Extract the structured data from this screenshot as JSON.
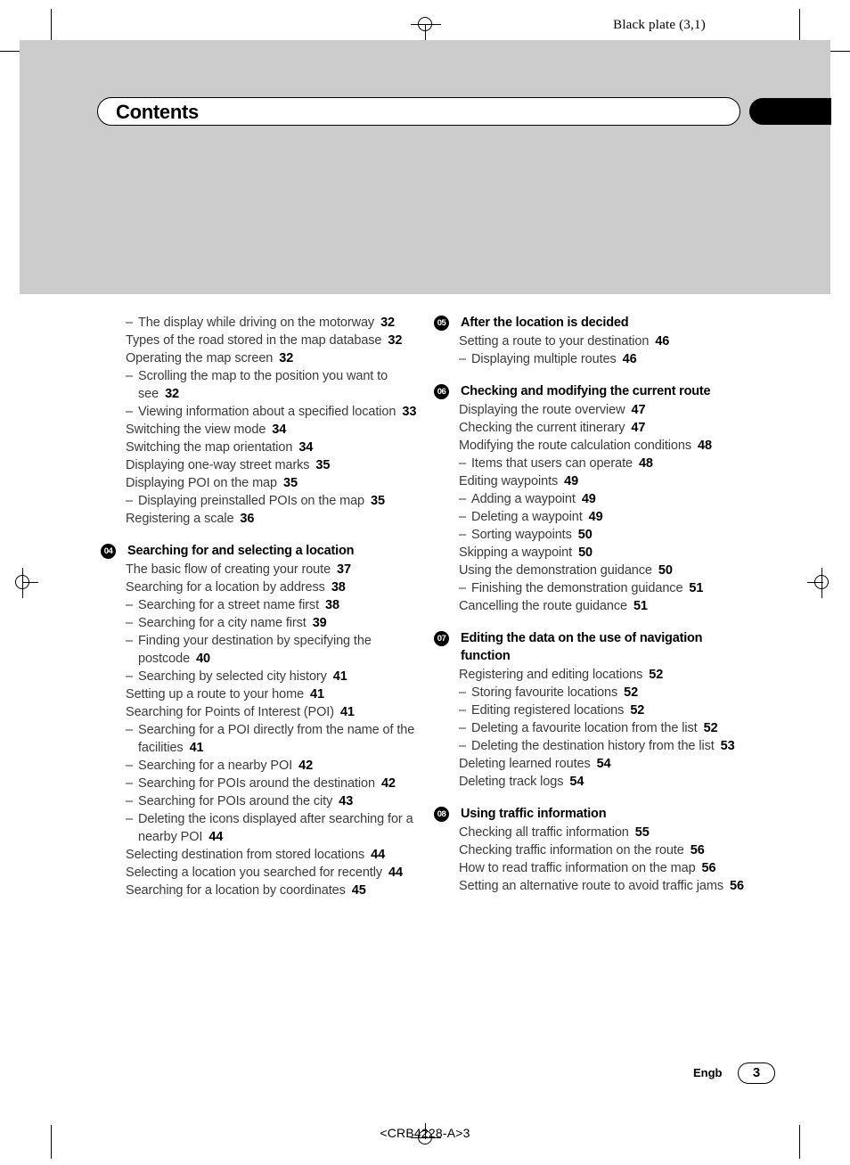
{
  "header": {
    "black_plate": "Black plate (3,1)",
    "title": "Contents"
  },
  "footer": {
    "language": "Engb",
    "page_number": "3",
    "doc_code": "<CRB4228-A>3"
  },
  "colors": {
    "band": "#cccccc",
    "tab": "#000000",
    "text": "#3b3b3b",
    "page_number_text": "#000000"
  },
  "toc": {
    "left_column": [
      {
        "kind": "sub",
        "text": "The display while driving on the motorway",
        "page": "32"
      },
      {
        "kind": "entry",
        "text": "Types of the road stored in the map database",
        "page": "32"
      },
      {
        "kind": "entry",
        "text": "Operating the map screen",
        "page": "32"
      },
      {
        "kind": "sub",
        "text": "Scrolling the map to the position you want to see",
        "page": "32"
      },
      {
        "kind": "sub",
        "text": "Viewing information about a specified location",
        "page": "33"
      },
      {
        "kind": "entry",
        "text": "Switching the view mode",
        "page": "34"
      },
      {
        "kind": "entry",
        "text": "Switching the map orientation",
        "page": "34"
      },
      {
        "kind": "entry",
        "text": "Displaying one-way street marks",
        "page": "35"
      },
      {
        "kind": "entry",
        "text": "Displaying POI on the map",
        "page": "35"
      },
      {
        "kind": "sub",
        "text": "Displaying preinstalled POIs on the map",
        "page": "35"
      },
      {
        "kind": "entry",
        "text": "Registering a scale",
        "page": "36"
      },
      {
        "kind": "head",
        "number": "04",
        "text": "Searching for and selecting a location"
      },
      {
        "kind": "entry",
        "text": "The basic flow of creating your route",
        "page": "37"
      },
      {
        "kind": "entry",
        "text": "Searching for a location by address",
        "page": "38"
      },
      {
        "kind": "sub",
        "text": "Searching for a street name first",
        "page": "38"
      },
      {
        "kind": "sub",
        "text": "Searching for a city name first",
        "page": "39"
      },
      {
        "kind": "sub",
        "text": "Finding your destination by specifying the postcode",
        "page": "40"
      },
      {
        "kind": "sub",
        "text": "Searching by selected city history",
        "page": "41"
      },
      {
        "kind": "entry",
        "text": "Setting up a route to your home",
        "page": "41"
      },
      {
        "kind": "entry",
        "text": "Searching for Points of Interest (POI)",
        "page": "41"
      },
      {
        "kind": "sub",
        "text": "Searching for a POI directly from the name of the facilities",
        "page": "41"
      },
      {
        "kind": "sub",
        "text": "Searching for a nearby POI",
        "page": "42"
      },
      {
        "kind": "sub",
        "text": "Searching for POIs around the destination",
        "page": "42"
      },
      {
        "kind": "sub",
        "text": "Searching for POIs around the city",
        "page": "43"
      },
      {
        "kind": "sub",
        "text": "Deleting the icons displayed after searching for a nearby POI",
        "page": "44"
      },
      {
        "kind": "entry",
        "text": "Selecting destination from stored locations",
        "page": "44"
      },
      {
        "kind": "entry",
        "text": "Selecting a location you searched for recently",
        "page": "44"
      },
      {
        "kind": "entry",
        "text": "Searching for a location by coordinates",
        "page": "45"
      }
    ],
    "right_column": [
      {
        "kind": "head",
        "number": "05",
        "text": "After the location is decided"
      },
      {
        "kind": "entry",
        "text": "Setting a route to your destination",
        "page": "46"
      },
      {
        "kind": "sub",
        "text": "Displaying multiple routes",
        "page": "46"
      },
      {
        "kind": "head",
        "number": "06",
        "text": "Checking and modifying the current route"
      },
      {
        "kind": "entry",
        "text": "Displaying the route overview",
        "page": "47"
      },
      {
        "kind": "entry",
        "text": "Checking the current itinerary",
        "page": "47"
      },
      {
        "kind": "entry",
        "text": "Modifying the route calculation conditions",
        "page": "48"
      },
      {
        "kind": "sub",
        "text": "Items that users can operate",
        "page": "48"
      },
      {
        "kind": "entry",
        "text": "Editing waypoints",
        "page": "49"
      },
      {
        "kind": "sub",
        "text": "Adding a waypoint",
        "page": "49"
      },
      {
        "kind": "sub",
        "text": "Deleting a waypoint",
        "page": "49"
      },
      {
        "kind": "sub",
        "text": "Sorting waypoints",
        "page": "50"
      },
      {
        "kind": "entry",
        "text": "Skipping a waypoint",
        "page": "50"
      },
      {
        "kind": "entry",
        "text": "Using the demonstration guidance",
        "page": "50"
      },
      {
        "kind": "sub",
        "text": "Finishing the demonstration guidance",
        "page": "51"
      },
      {
        "kind": "entry",
        "text": "Cancelling the route guidance",
        "page": "51"
      },
      {
        "kind": "head",
        "number": "07",
        "text": "Editing the data on the use of navigation function"
      },
      {
        "kind": "entry",
        "text": "Registering and editing locations",
        "page": "52"
      },
      {
        "kind": "sub",
        "text": "Storing favourite locations",
        "page": "52"
      },
      {
        "kind": "sub",
        "text": "Editing registered locations",
        "page": "52"
      },
      {
        "kind": "sub",
        "text": "Deleting a favourite location from the list",
        "page": "52"
      },
      {
        "kind": "sub",
        "text": "Deleting the destination history from the list",
        "page": "53"
      },
      {
        "kind": "entry",
        "text": "Deleting learned routes",
        "page": "54"
      },
      {
        "kind": "entry",
        "text": "Deleting track logs",
        "page": "54"
      },
      {
        "kind": "head",
        "number": "08",
        "text": "Using traffic information"
      },
      {
        "kind": "entry",
        "text": "Checking all traffic information",
        "page": "55"
      },
      {
        "kind": "entry",
        "text": "Checking traffic information on the route",
        "page": "56"
      },
      {
        "kind": "entry",
        "text": "How to read traffic information on the map",
        "page": "56"
      },
      {
        "kind": "entry",
        "text": "Setting an alternative route to avoid traffic jams",
        "page": "56"
      }
    ]
  }
}
